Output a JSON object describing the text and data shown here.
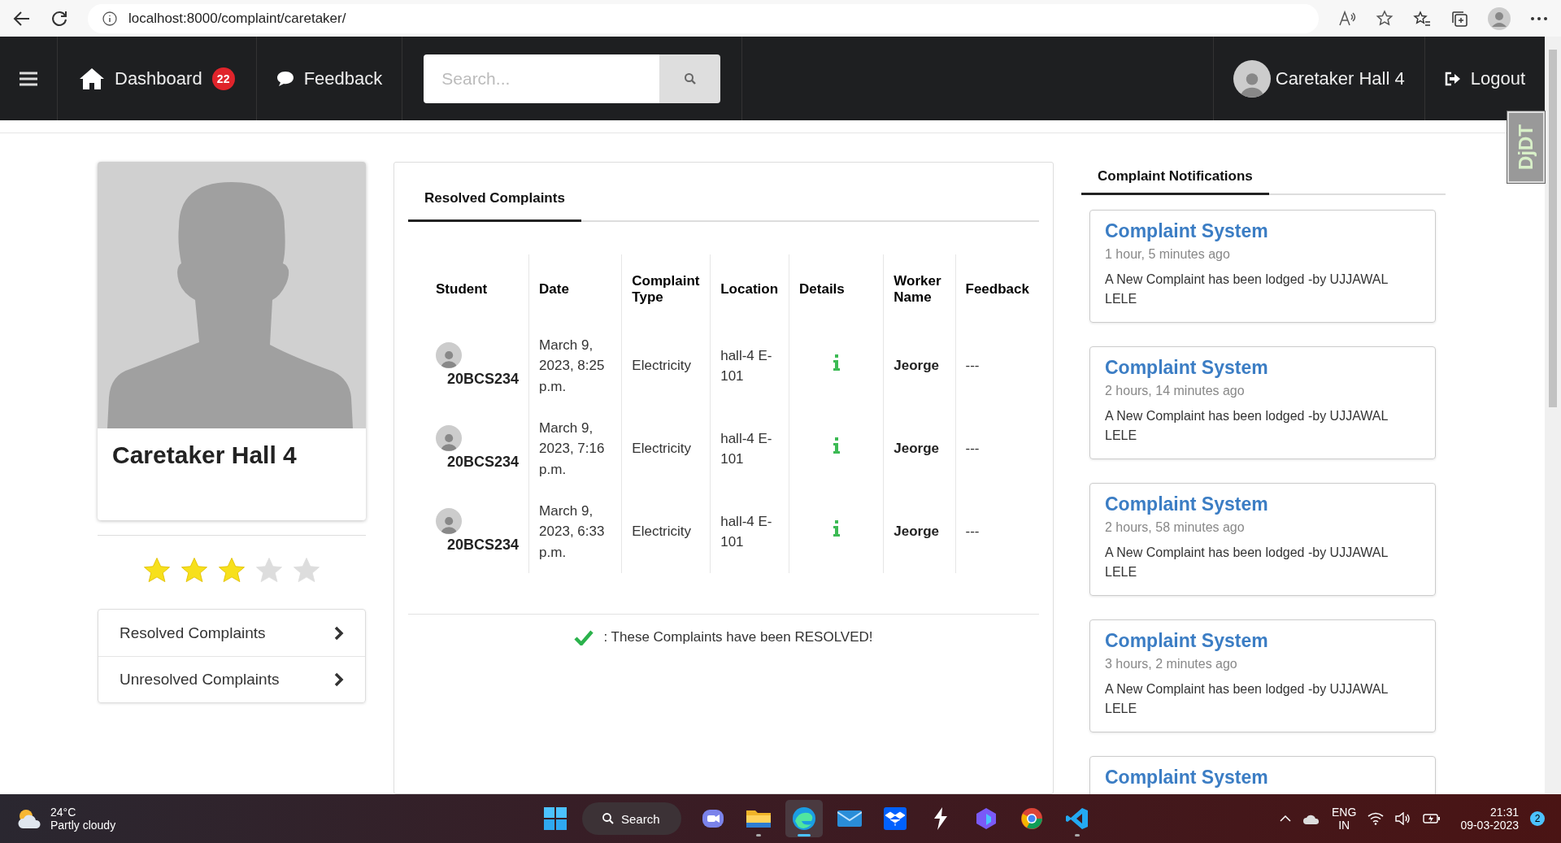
{
  "browser": {
    "url": "localhost:8000/complaint/caretaker/"
  },
  "navbar": {
    "dashboard": {
      "label": "Dashboard",
      "badge": "22"
    },
    "feedback": {
      "label": "Feedback"
    },
    "search": {
      "placeholder": "Search..."
    },
    "user": {
      "name": "Caretaker Hall 4"
    },
    "logout": {
      "label": "Logout"
    }
  },
  "debug_toolbar": {
    "label": "DjDT"
  },
  "profile": {
    "name": "Caretaker Hall 4",
    "stars": 3,
    "links": [
      {
        "label": "Resolved Complaints"
      },
      {
        "label": "Unresolved Complaints"
      }
    ]
  },
  "complaints": {
    "tab": "Resolved Complaints",
    "columns": [
      "Student",
      "Date",
      "Complaint Type",
      "Location",
      "Details",
      "Worker Name",
      "Feedback"
    ],
    "rows": [
      {
        "student": "20BCS234",
        "date": "March 9, 2023, 8:25 p.m.",
        "type": "Electricity",
        "location": "hall-4 E-101",
        "worker": "Jeorge",
        "feedback": "---"
      },
      {
        "student": "20BCS234",
        "date": "March 9, 2023, 7:16 p.m.",
        "type": "Electricity",
        "location": "hall-4 E-101",
        "worker": "Jeorge",
        "feedback": "---"
      },
      {
        "student": "20BCS234",
        "date": "March 9, 2023, 6:33 p.m.",
        "type": "Electricity",
        "location": "hall-4 E-101",
        "worker": "Jeorge",
        "feedback": "---"
      }
    ],
    "note": ": These Complaints have been RESOLVED!"
  },
  "notifications": {
    "tab": "Complaint Notifications",
    "items": [
      {
        "title": "Complaint System",
        "time": "1 hour, 5 minutes ago",
        "message": "A New Complaint has been lodged -by UJJAWAL LELE"
      },
      {
        "title": "Complaint System",
        "time": "2 hours, 14 minutes ago",
        "message": "A New Complaint has been lodged -by UJJAWAL LELE"
      },
      {
        "title": "Complaint System",
        "time": "2 hours, 58 minutes ago",
        "message": "A New Complaint has been lodged -by UJJAWAL LELE"
      },
      {
        "title": "Complaint System",
        "time": "3 hours, 2 minutes ago",
        "message": "A New Complaint has been lodged -by UJJAWAL LELE"
      },
      {
        "title": "Complaint System"
      }
    ]
  },
  "taskbar": {
    "weather": {
      "temp": "24°C",
      "text": "Partly cloudy"
    },
    "search": "Search",
    "apps": [
      {
        "kind": "start",
        "running": false,
        "selected": false
      },
      {
        "kind": "chat",
        "running": false,
        "selected": false
      },
      {
        "kind": "folder",
        "running": true,
        "selected": false
      },
      {
        "kind": "browser",
        "running": true,
        "selected": true
      },
      {
        "kind": "mail",
        "running": false,
        "selected": false
      },
      {
        "kind": "box",
        "running": false,
        "selected": false
      },
      {
        "kind": "bolt",
        "running": false,
        "selected": false
      },
      {
        "kind": "hexagon",
        "running": false,
        "selected": false
      },
      {
        "kind": "circle",
        "running": false,
        "selected": false
      },
      {
        "kind": "code",
        "running": true,
        "selected": false
      }
    ],
    "language": "ENG",
    "region": "IN",
    "time": "21:31",
    "date": "09-03-2023",
    "badge": "2"
  }
}
